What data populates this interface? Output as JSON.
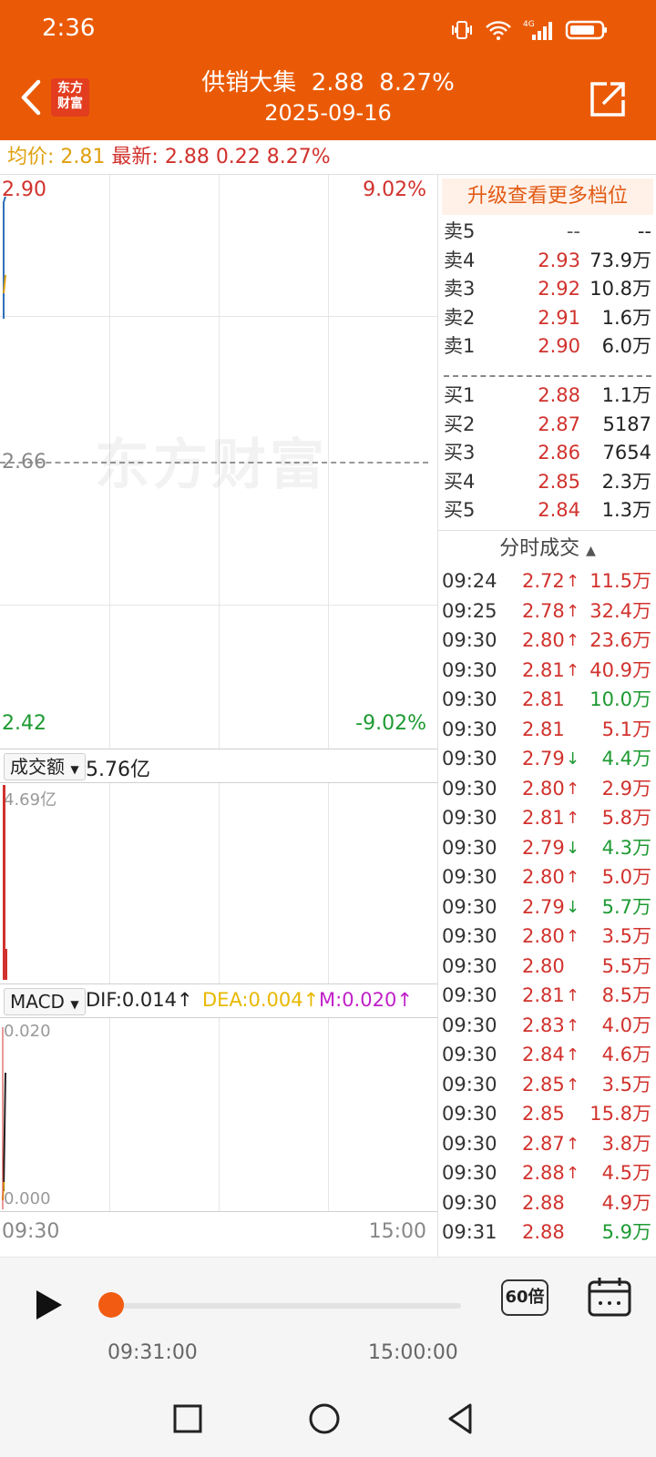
{
  "status_bar": {
    "time": "2:36"
  },
  "header": {
    "logo_line1": "东方",
    "logo_line2": "财富",
    "stock_name": "供销大集",
    "price": "2.88",
    "change_pct": "8.27%",
    "date": "2025-09-16"
  },
  "info_bar": {
    "avg_label": "均价:",
    "avg_value": "2.81",
    "latest_label": "最新:",
    "latest_value": "2.88",
    "change": "0.22",
    "change_pct": "8.27%"
  },
  "chart": {
    "price_high": "2.90",
    "pct_high": "9.02%",
    "price_mid": "2.66",
    "price_low": "2.42",
    "pct_low": "-9.02%",
    "watermark": "东方财富",
    "volume_selector": "成交额",
    "volume_total": "5.76亿",
    "volume_max": "4.69亿",
    "macd_selector": "MACD",
    "dif": "DIF:0.014",
    "dea": "DEA:0.004",
    "m": "M:0.020",
    "macd_max": "0.020",
    "macd_min": "0.000",
    "time_start": "09:30",
    "time_end": "15:00"
  },
  "order_book": {
    "upgrade_label": "升级查看更多档位",
    "asks": [
      {
        "label": "卖5",
        "price": "--",
        "volume": "--"
      },
      {
        "label": "卖4",
        "price": "2.93",
        "volume": "73.9万"
      },
      {
        "label": "卖3",
        "price": "2.92",
        "volume": "10.8万"
      },
      {
        "label": "卖2",
        "price": "2.91",
        "volume": "1.6万"
      },
      {
        "label": "卖1",
        "price": "2.90",
        "volume": "6.0万"
      }
    ],
    "bids": [
      {
        "label": "买1",
        "price": "2.88",
        "volume": "1.1万"
      },
      {
        "label": "买2",
        "price": "2.87",
        "volume": "5187"
      },
      {
        "label": "买3",
        "price": "2.86",
        "volume": "7654"
      },
      {
        "label": "买4",
        "price": "2.85",
        "volume": "2.3万"
      },
      {
        "label": "买5",
        "price": "2.84",
        "volume": "1.3万"
      }
    ]
  },
  "trades": {
    "header": "分时成交",
    "rows": [
      {
        "time": "09:24",
        "price": "2.72",
        "arrow": "↑",
        "volume": "11.5万",
        "color": "red"
      },
      {
        "time": "09:25",
        "price": "2.78",
        "arrow": "↑",
        "volume": "32.4万",
        "color": "red"
      },
      {
        "time": "09:30",
        "price": "2.80",
        "arrow": "↑",
        "volume": "23.6万",
        "color": "red"
      },
      {
        "time": "09:30",
        "price": "2.81",
        "arrow": "↑",
        "volume": "40.9万",
        "color": "red"
      },
      {
        "time": "09:30",
        "price": "2.81",
        "arrow": "",
        "volume": "10.0万",
        "color": "green"
      },
      {
        "time": "09:30",
        "price": "2.81",
        "arrow": "",
        "volume": "5.1万",
        "color": "red"
      },
      {
        "time": "09:30",
        "price": "2.79",
        "arrow": "↓",
        "volume": "4.4万",
        "color": "green"
      },
      {
        "time": "09:30",
        "price": "2.80",
        "arrow": "↑",
        "volume": "2.9万",
        "color": "red"
      },
      {
        "time": "09:30",
        "price": "2.81",
        "arrow": "↑",
        "volume": "5.8万",
        "color": "red"
      },
      {
        "time": "09:30",
        "price": "2.79",
        "arrow": "↓",
        "volume": "4.3万",
        "color": "green"
      },
      {
        "time": "09:30",
        "price": "2.80",
        "arrow": "↑",
        "volume": "5.0万",
        "color": "red"
      },
      {
        "time": "09:30",
        "price": "2.79",
        "arrow": "↓",
        "volume": "5.7万",
        "color": "green"
      },
      {
        "time": "09:30",
        "price": "2.80",
        "arrow": "↑",
        "volume": "3.5万",
        "color": "red"
      },
      {
        "time": "09:30",
        "price": "2.80",
        "arrow": "",
        "volume": "5.5万",
        "color": "red"
      },
      {
        "time": "09:30",
        "price": "2.81",
        "arrow": "↑",
        "volume": "8.5万",
        "color": "red"
      },
      {
        "time": "09:30",
        "price": "2.83",
        "arrow": "↑",
        "volume": "4.0万",
        "color": "red"
      },
      {
        "time": "09:30",
        "price": "2.84",
        "arrow": "↑",
        "volume": "4.6万",
        "color": "red"
      },
      {
        "time": "09:30",
        "price": "2.85",
        "arrow": "↑",
        "volume": "3.5万",
        "color": "red"
      },
      {
        "time": "09:30",
        "price": "2.85",
        "arrow": "",
        "volume": "15.8万",
        "color": "red"
      },
      {
        "time": "09:30",
        "price": "2.87",
        "arrow": "↑",
        "volume": "3.8万",
        "color": "red"
      },
      {
        "time": "09:30",
        "price": "2.88",
        "arrow": "↑",
        "volume": "4.5万",
        "color": "red"
      },
      {
        "time": "09:30",
        "price": "2.88",
        "arrow": "",
        "volume": "4.9万",
        "color": "red"
      },
      {
        "time": "09:31",
        "price": "2.88",
        "arrow": "",
        "volume": "5.9万",
        "color": "green"
      }
    ]
  },
  "player": {
    "current_time": "09:31:00",
    "end_time": "15:00:00",
    "speed": "60倍",
    "progress": 0
  },
  "colors": {
    "brand": "#ea5a06",
    "up": "#d1322d",
    "down": "#1d9a32"
  }
}
